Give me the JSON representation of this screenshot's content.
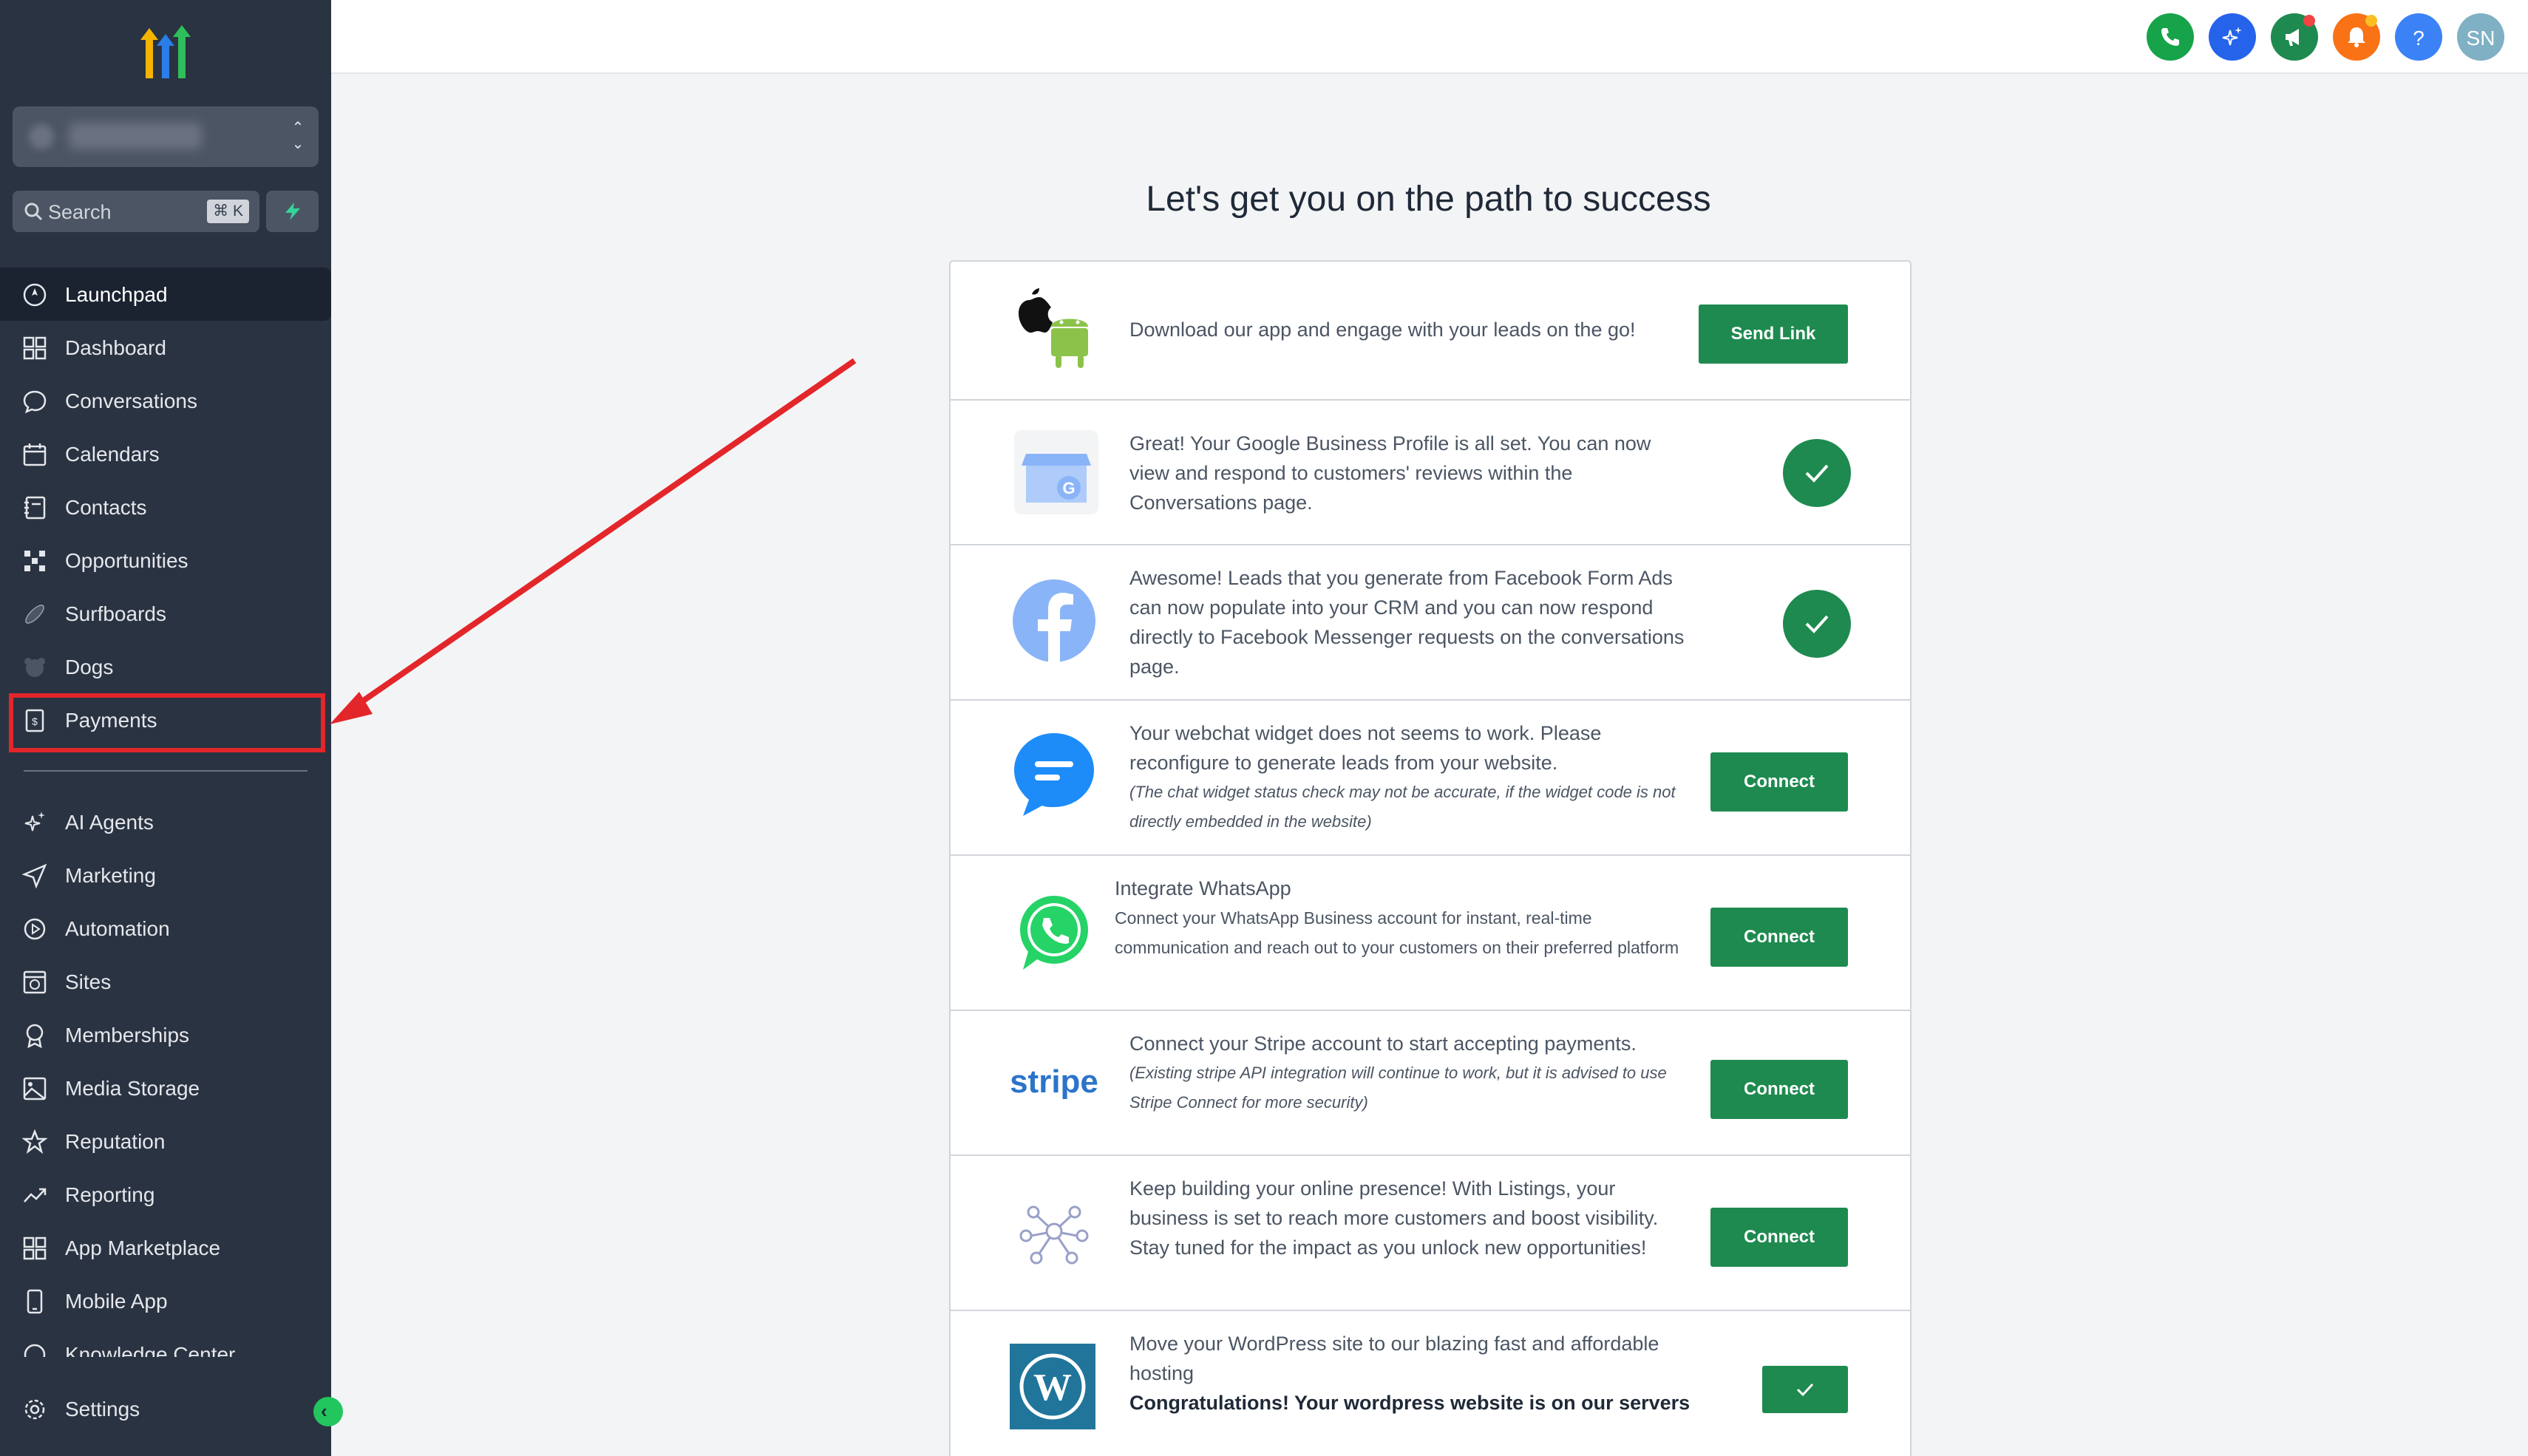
{
  "sidebar": {
    "search_placeholder": "Search",
    "search_shortcut": "⌘ K",
    "items": [
      {
        "label": "Launchpad",
        "icon": "rocket-icon",
        "active": true
      },
      {
        "label": "Dashboard",
        "icon": "grid-icon"
      },
      {
        "label": "Conversations",
        "icon": "chat-bubble-icon"
      },
      {
        "label": "Calendars",
        "icon": "calendar-icon"
      },
      {
        "label": "Contacts",
        "icon": "contacts-book-icon"
      },
      {
        "label": "Opportunities",
        "icon": "network-icon"
      },
      {
        "label": "Surfboards",
        "icon": "surfboard-icon"
      },
      {
        "label": "Dogs",
        "icon": "dog-icon"
      },
      {
        "label": "Payments",
        "icon": "invoice-icon"
      }
    ],
    "items2": [
      {
        "label": "AI Agents",
        "icon": "sparkle-icon"
      },
      {
        "label": "Marketing",
        "icon": "send-icon"
      },
      {
        "label": "Automation",
        "icon": "automation-icon"
      },
      {
        "label": "Sites",
        "icon": "globe-icon"
      },
      {
        "label": "Memberships",
        "icon": "award-icon"
      },
      {
        "label": "Media Storage",
        "icon": "image-icon"
      },
      {
        "label": "Reputation",
        "icon": "star-icon"
      },
      {
        "label": "Reporting",
        "icon": "trend-icon"
      },
      {
        "label": "App Marketplace",
        "icon": "apps-grid-icon"
      },
      {
        "label": "Mobile App",
        "icon": "phone-icon"
      },
      {
        "label": "Knowledge Center",
        "icon": "book-icon"
      }
    ],
    "settings_label": "Settings"
  },
  "topbar": {
    "avatar_initials": "SN",
    "help_label": "?",
    "colors": {
      "phone": "#16a34a",
      "ai": "#2563eb",
      "announce": "#1e8a4f",
      "bell": "#f97316",
      "help": "#3b82f6",
      "avatar": "#7fb0c4"
    }
  },
  "main": {
    "title": "Let's get you on the path to success",
    "rows": [
      {
        "text": "Download our app and engage with your leads on the go!",
        "button": "Send Link"
      },
      {
        "text": "Great! Your Google Business Profile is all set. You can now view and respond to customers' reviews within the Conversations page."
      },
      {
        "text": "Awesome! Leads that you generate from Facebook Form Ads can now populate into your CRM and you can now respond directly to Facebook Messenger requests on the conversations page."
      },
      {
        "text": "Your webchat widget does not seems to work. Please reconfigure to generate leads from your website.",
        "note": "(The chat widget status check may not be accurate, if the widget code is not directly embedded in the website)",
        "button": "Connect"
      },
      {
        "title": "Integrate WhatsApp",
        "text": "Connect your WhatsApp Business account for instant, real-time communication and reach out to your customers on their preferred platform",
        "button": "Connect"
      },
      {
        "text": "Connect your Stripe account to start accepting payments.",
        "note": "(Existing stripe API integration will continue to work, but it is advised to use Stripe Connect for more security)",
        "button": "Connect",
        "logo_text": "stripe"
      },
      {
        "text": "Keep building your online presence! With Listings, your business is set to reach more customers and boost visibility. Stay tuned for the impact as you unlock new opportunities!",
        "button": "Connect"
      },
      {
        "text": "Move your WordPress site to our blazing fast and affordable hosting",
        "bold": "Congratulations! Your wordpress website is on our servers"
      }
    ]
  },
  "accent_colors": {
    "brand_green": "#1e8a4f",
    "highlight_red": "#e3262a"
  }
}
